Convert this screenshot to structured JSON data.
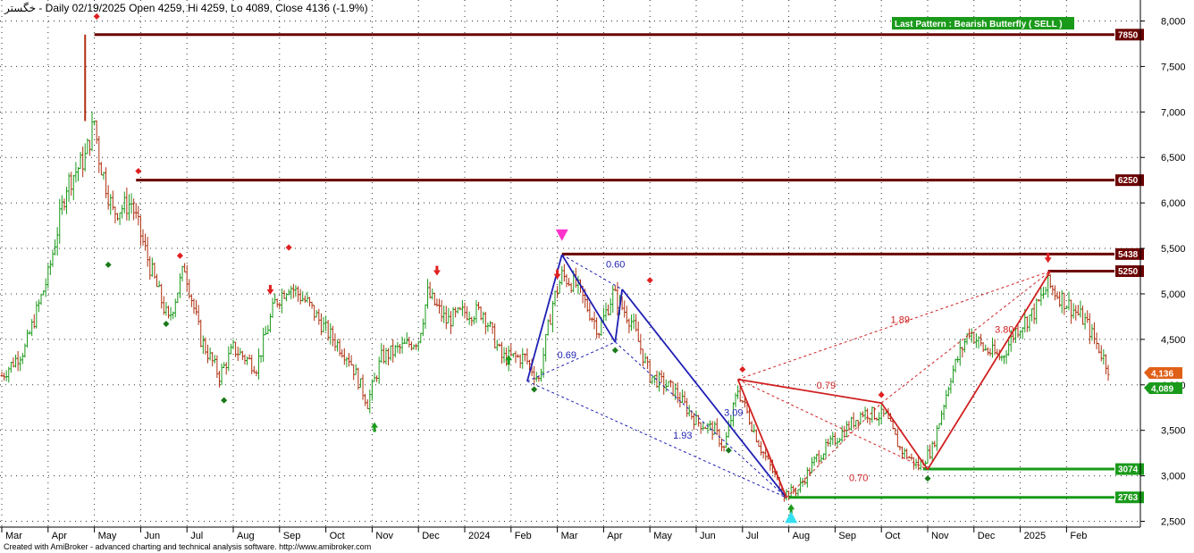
{
  "header": {
    "title": "خگستر - Daily 02/19/2025 Open 4259, Hi 4259, Lo 4089, Close 4136 (-1.9%)",
    "pattern_badge": "Last Pattern : Bearish Butterfly ( SELL )"
  },
  "footer": {
    "credit": "Created with AmiBroker - advanced charting and technical analysis software. http://www.amibroker.com"
  },
  "colors": {
    "up_bar": "#1a9a1a",
    "down_bar": "#b03010",
    "resistance": "#6b0000",
    "support": "#1a9a1a",
    "pattern_blue": "#1f1fb4",
    "pattern_red": "#d02020",
    "price_tag": "#e06018",
    "low_tag": "#1a9a1a"
  },
  "chart_data": {
    "type": "ohlc",
    "price_axis": {
      "ticks": [
        8000,
        7500,
        7000,
        6500,
        6000,
        5500,
        5000,
        4500,
        4000,
        3500,
        3000,
        2500
      ],
      "tick_labels": [
        "8,000",
        "7,500",
        "7,000",
        "6,500",
        "6,000",
        "5,500",
        "5,000",
        "4,500",
        "4,000",
        "3,500",
        "3,000",
        "2,500"
      ],
      "range": [
        2450,
        8250
      ]
    },
    "time_axis": {
      "labels": [
        "Mar",
        "Apr",
        "May",
        "Jun",
        "Jul",
        "Aug",
        "Sep",
        "Oct",
        "Nov",
        "Dec",
        "2024",
        "Feb",
        "Mar",
        "Apr",
        "May",
        "Jun",
        "Jul",
        "Aug",
        "Sep",
        "Oct",
        "Nov",
        "Dec",
        "2025",
        "Feb"
      ]
    },
    "last_bar": {
      "date": "02/19/2025",
      "open": 4259,
      "high": 4259,
      "low": 4089,
      "close": 4136,
      "change": "-1.9%"
    },
    "price_path": [
      {
        "m": 0.0,
        "p": 4100
      },
      {
        "m": 0.5,
        "p": 4400
      },
      {
        "m": 1.0,
        "p": 5200
      },
      {
        "m": 1.4,
        "p": 6200
      },
      {
        "m": 1.8,
        "p": 6500
      },
      {
        "m": 2.0,
        "p": 6900
      },
      {
        "m": 2.1,
        "p": 6500
      },
      {
        "m": 2.4,
        "p": 5900
      },
      {
        "m": 2.8,
        "p": 6000
      },
      {
        "m": 3.2,
        "p": 5300
      },
      {
        "m": 3.6,
        "p": 4700
      },
      {
        "m": 3.95,
        "p": 5300
      },
      {
        "m": 4.3,
        "p": 4500
      },
      {
        "m": 4.7,
        "p": 4100
      },
      {
        "m": 5.0,
        "p": 4400
      },
      {
        "m": 5.5,
        "p": 4200
      },
      {
        "m": 5.9,
        "p": 4900
      },
      {
        "m": 6.2,
        "p": 5100
      },
      {
        "m": 6.6,
        "p": 4900
      },
      {
        "m": 7.0,
        "p": 4600
      },
      {
        "m": 7.5,
        "p": 4300
      },
      {
        "m": 7.9,
        "p": 3800
      },
      {
        "m": 8.2,
        "p": 4300
      },
      {
        "m": 8.6,
        "p": 4400
      },
      {
        "m": 9.0,
        "p": 4500
      },
      {
        "m": 9.2,
        "p": 5000
      },
      {
        "m": 9.6,
        "p": 4700
      },
      {
        "m": 10.0,
        "p": 4800
      },
      {
        "m": 10.4,
        "p": 4800
      },
      {
        "m": 10.8,
        "p": 4300
      },
      {
        "m": 11.3,
        "p": 4300
      },
      {
        "m": 11.6,
        "p": 4050
      },
      {
        "m": 11.9,
        "p": 4900
      },
      {
        "m": 12.1,
        "p": 5200
      },
      {
        "m": 12.4,
        "p": 5100
      },
      {
        "m": 12.9,
        "p": 4600
      },
      {
        "m": 13.2,
        "p": 5000
      },
      {
        "m": 13.6,
        "p": 4700
      },
      {
        "m": 14.0,
        "p": 4100
      },
      {
        "m": 14.5,
        "p": 3950
      },
      {
        "m": 15.0,
        "p": 3600
      },
      {
        "m": 15.4,
        "p": 3500
      },
      {
        "m": 15.6,
        "p": 3300
      },
      {
        "m": 15.9,
        "p": 3950
      },
      {
        "m": 16.4,
        "p": 3300
      },
      {
        "m": 16.9,
        "p": 2800
      },
      {
        "m": 17.2,
        "p": 2850
      },
      {
        "m": 17.6,
        "p": 3200
      },
      {
        "m": 18.0,
        "p": 3400
      },
      {
        "m": 18.6,
        "p": 3700
      },
      {
        "m": 19.1,
        "p": 3650
      },
      {
        "m": 19.4,
        "p": 3300
      },
      {
        "m": 19.8,
        "p": 3100
      },
      {
        "m": 20.1,
        "p": 3300
      },
      {
        "m": 20.5,
        "p": 4100
      },
      {
        "m": 20.9,
        "p": 4600
      },
      {
        "m": 21.2,
        "p": 4400
      },
      {
        "m": 21.6,
        "p": 4300
      },
      {
        "m": 21.9,
        "p": 4600
      },
      {
        "m": 22.3,
        "p": 4800
      },
      {
        "m": 22.6,
        "p": 5100
      },
      {
        "m": 23.0,
        "p": 4900
      },
      {
        "m": 23.4,
        "p": 4700
      },
      {
        "m": 23.7,
        "p": 4400
      },
      {
        "m": 23.95,
        "p": 4136
      }
    ],
    "levels": [
      {
        "value": 7850,
        "label": "7850",
        "kind": "resistance",
        "start_m": 2.0
      },
      {
        "value": 6250,
        "label": "6250",
        "kind": "resistance",
        "start_m": 2.9
      },
      {
        "value": 5438,
        "label": "5438",
        "kind": "resistance",
        "start_m": 12.1
      },
      {
        "value": 5250,
        "label": "5250",
        "kind": "resistance",
        "start_m": 22.6
      },
      {
        "value": 3074,
        "label": "3074",
        "kind": "support",
        "start_m": 19.9
      },
      {
        "value": 2763,
        "label": "2763",
        "kind": "support",
        "start_m": 17.0
      }
    ],
    "current_price_tag": "4,136",
    "low_tag": "4,089",
    "bearish_pattern": {
      "points": [
        {
          "m": 11.35,
          "p": 4040
        },
        {
          "m": 12.1,
          "p": 5430
        },
        {
          "m": 13.25,
          "p": 4470
        },
        {
          "m": 13.4,
          "p": 5050
        },
        {
          "m": 16.95,
          "p": 2760
        }
      ],
      "ratios": [
        {
          "text": "0.60",
          "m": 13.05,
          "p": 5290
        },
        {
          "text": "0.69",
          "m": 12.0,
          "p": 4290
        },
        {
          "text": "3.09",
          "m": 15.6,
          "p": 3660
        },
        {
          "text": "1.93",
          "m": 14.5,
          "p": 3410
        }
      ]
    },
    "bullish_pattern": {
      "points": [
        {
          "m": 16.95,
          "p": 2760
        },
        {
          "m": 15.9,
          "p": 4060
        },
        {
          "m": 19.0,
          "p": 3800
        },
        {
          "m": 20.0,
          "p": 3070
        },
        {
          "m": 22.65,
          "p": 5250
        }
      ],
      "ratios": [
        {
          "text": "1.89",
          "m": 19.2,
          "p": 4680
        },
        {
          "text": "0.79",
          "m": 17.6,
          "p": 3960
        },
        {
          "text": "0.70",
          "m": 18.3,
          "p": 2940
        },
        {
          "text": "3.80",
          "m": 21.45,
          "p": 4570
        }
      ]
    },
    "markers": [
      {
        "kind": "top-dot",
        "m": 2.05,
        "p": 8050
      },
      {
        "kind": "top-dot",
        "m": 2.95,
        "p": 6350
      },
      {
        "kind": "top-dot",
        "m": 3.85,
        "p": 5420
      },
      {
        "kind": "top-dot",
        "m": 6.2,
        "p": 5510
      },
      {
        "kind": "top-dot",
        "m": 14.0,
        "p": 5150
      },
      {
        "kind": "top-dot",
        "m": 16.0,
        "p": 4170
      },
      {
        "kind": "top-dot",
        "m": 19.0,
        "p": 3890
      },
      {
        "kind": "bottom-dot",
        "m": 2.3,
        "p": 5320
      },
      {
        "kind": "bottom-dot",
        "m": 3.55,
        "p": 4670
      },
      {
        "kind": "bottom-dot",
        "m": 4.8,
        "p": 3830
      },
      {
        "kind": "bottom-dot",
        "m": 11.5,
        "p": 3950
      },
      {
        "kind": "bottom-dot",
        "m": 13.25,
        "p": 4380
      },
      {
        "kind": "bottom-dot",
        "m": 15.7,
        "p": 3280
      },
      {
        "kind": "bottom-dot",
        "m": 20.0,
        "p": 2970
      },
      {
        "kind": "sell-arrow",
        "m": 5.8,
        "p": 5020
      },
      {
        "kind": "sell-arrow",
        "m": 9.4,
        "p": 5230
      },
      {
        "kind": "sell-arrow",
        "m": 12.0,
        "p": 5190
      },
      {
        "kind": "sell-arrow",
        "m": 22.6,
        "p": 5370
      },
      {
        "kind": "buy-arrow",
        "m": 8.05,
        "p": 3560
      },
      {
        "kind": "buy-arrow",
        "m": 10.95,
        "p": 4300
      },
      {
        "kind": "buy-arrow",
        "m": 17.05,
        "p": 2660
      },
      {
        "kind": "sell-triangle",
        "m": 12.1,
        "p": 5650
      },
      {
        "kind": "buy-triangle",
        "m": 17.05,
        "p": 2540
      }
    ]
  }
}
